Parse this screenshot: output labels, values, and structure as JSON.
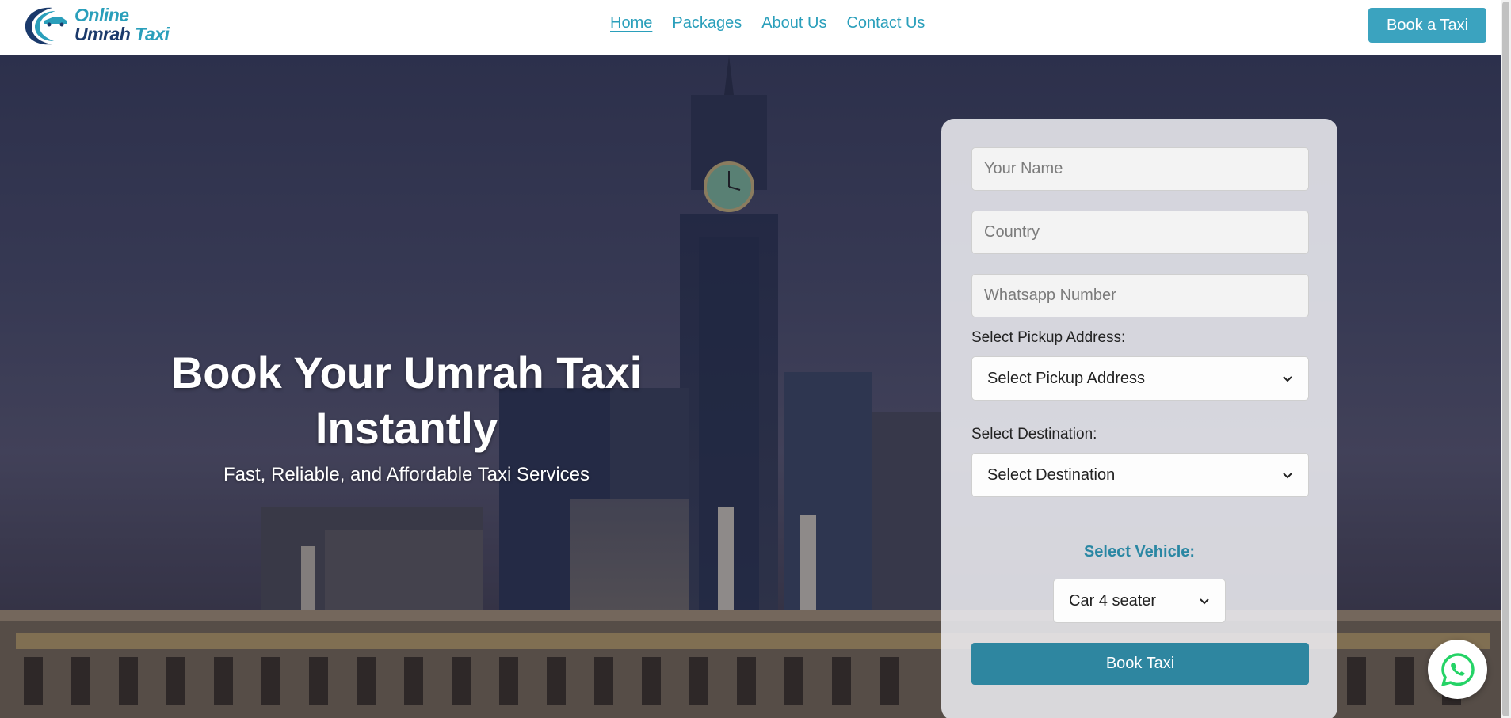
{
  "brand": {
    "line1": "Online",
    "line2_a": "Umrah",
    "line2_b": "Taxi",
    "logo_icon": "taxi-swoosh-icon",
    "colors": {
      "primary": "#2a9fbb",
      "navy": "#1b3a6b"
    }
  },
  "nav": {
    "items": [
      {
        "label": "Home",
        "active": true
      },
      {
        "label": "Packages",
        "active": false
      },
      {
        "label": "About Us",
        "active": false
      },
      {
        "label": "Contact Us",
        "active": false
      }
    ],
    "cta_label": "Book a Taxi"
  },
  "hero": {
    "title": "Book Your Umrah Taxi Instantly",
    "subtitle": "Fast, Reliable, and Affordable Taxi Services"
  },
  "form": {
    "name_placeholder": "Your Name",
    "country_placeholder": "Country",
    "whatsapp_placeholder": "Whatsapp Number",
    "pickup_label": "Select Pickup Address:",
    "pickup_value": "Select Pickup Address",
    "destination_label": "Select Destination:",
    "destination_value": "Select Destination",
    "vehicle_label": "Select Vehicle:",
    "vehicle_value": "Car 4 seater",
    "submit_label": "Book Taxi"
  },
  "floating": {
    "icon": "whatsapp-icon",
    "color": "#25d366"
  }
}
